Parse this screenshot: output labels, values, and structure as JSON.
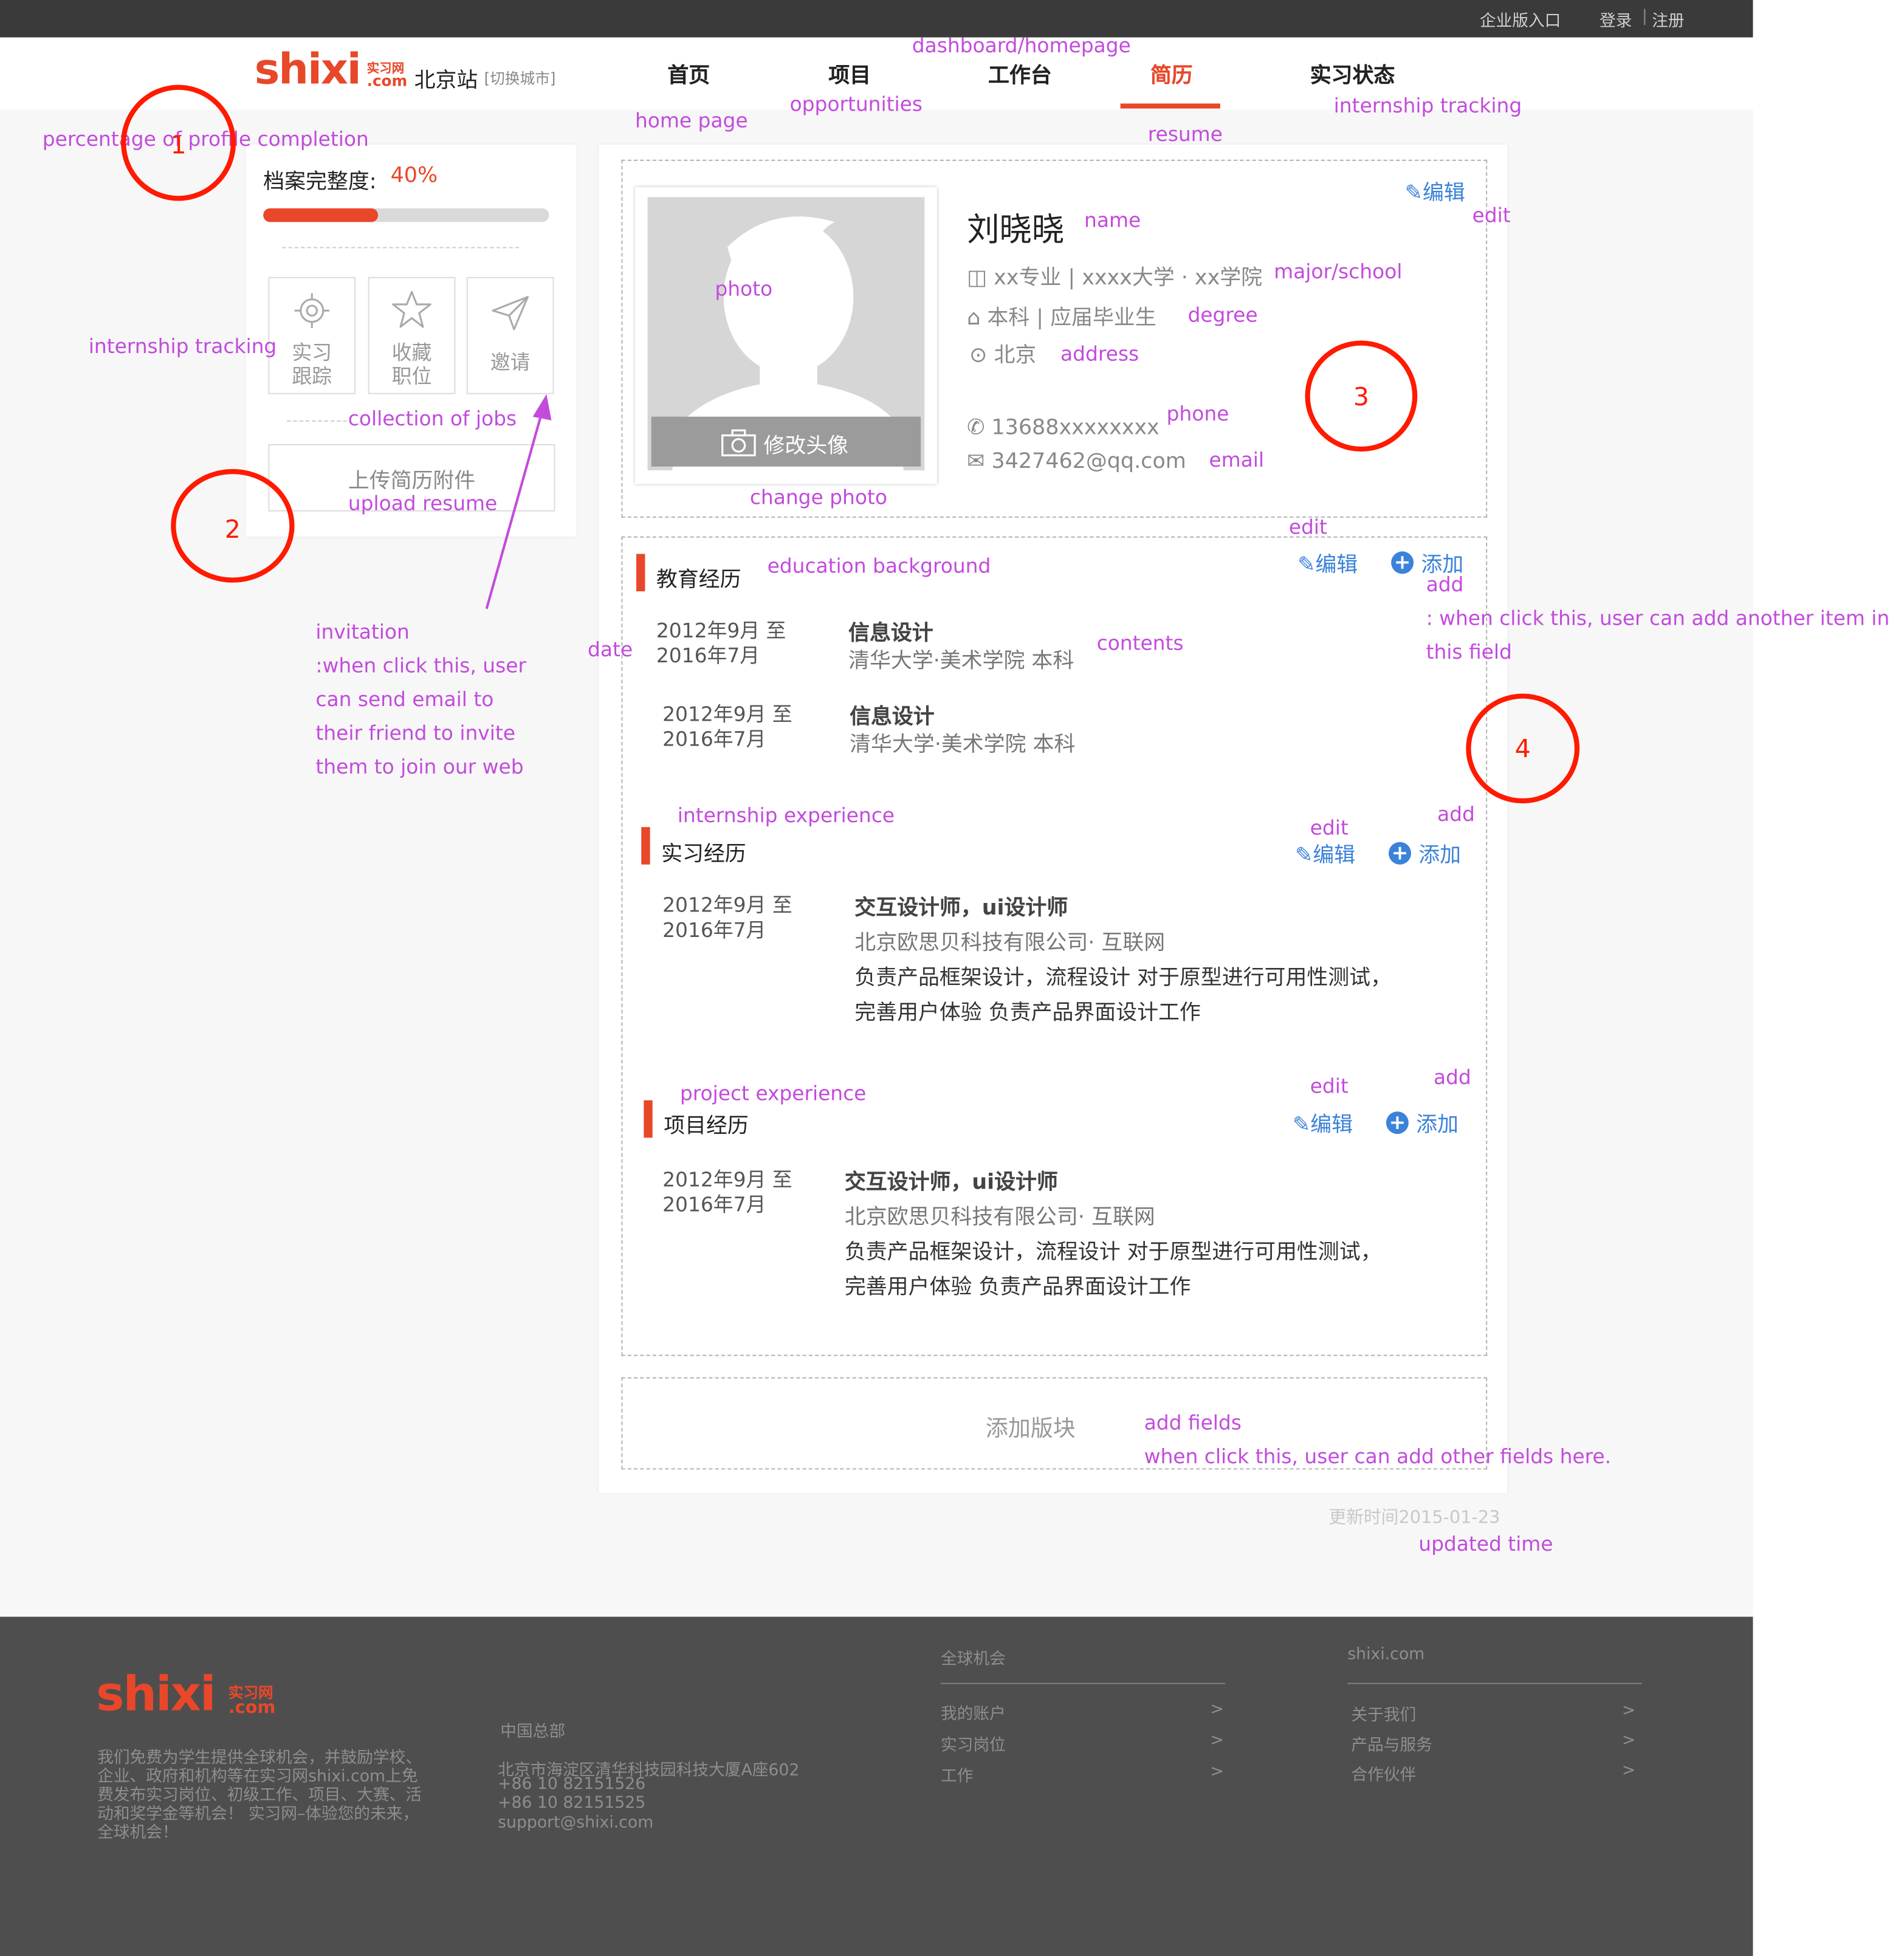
{
  "topbar": {
    "enterprise": "企业版入口",
    "login": "登录",
    "register": "注册"
  },
  "brand": {
    "logo_text": "shixi",
    "logo_small": "实习网",
    "logo_com": ".com",
    "city": "北京站",
    "switch_city": "[切换城市]"
  },
  "nav": {
    "items": [
      {
        "label": "首页",
        "active": false
      },
      {
        "label": "项目",
        "active": false
      },
      {
        "label": "工作台",
        "active": false
      },
      {
        "label": "简历",
        "active": true
      },
      {
        "label": "实习状态",
        "active": false
      }
    ]
  },
  "sidebar": {
    "completion_label": "档案完整度:",
    "completion_value": "40%",
    "completion_fraction": 0.4,
    "tiles": [
      {
        "label": "实习\n跟踪",
        "icon": "target-icon"
      },
      {
        "label": "收藏\n职位",
        "icon": "star-icon"
      },
      {
        "label": "邀请",
        "icon": "paper-plane-icon"
      }
    ],
    "upload_label": "上传简历附件"
  },
  "profile": {
    "edit_label": "编辑",
    "name": "刘晓晓",
    "major": "xx专业 | xxxx大学 · xx学院",
    "degree": "本科 | 应届毕业生",
    "address": "北京",
    "phone": "13688xxxxxxxx",
    "email": "3427462@qq.com",
    "change_photo": "修改头像"
  },
  "sections": {
    "edit_label": "编辑",
    "add_label": "添加",
    "education": {
      "title": "教育经历",
      "entries": [
        {
          "date1": "2012年9月 至",
          "date2": "2016年7月",
          "title": "信息设计",
          "sub": "清华大学·美术学院 本科"
        },
        {
          "date1": "2012年9月 至",
          "date2": "2016年7月",
          "title": "信息设计",
          "sub": "清华大学·美术学院 本科"
        }
      ]
    },
    "internship": {
      "title": "实习经历",
      "entry": {
        "date1": "2012年9月 至",
        "date2": "2016年7月",
        "title": "交互设计师，ui设计师",
        "sub": "北京欧思贝科技有限公司· 互联网",
        "desc1": "负责产品框架设计，流程设计 对于原型进行可用性测试，",
        "desc2": "完善用户体验 负责产品界面设计工作"
      }
    },
    "project": {
      "title": "项目经历",
      "entry": {
        "date1": "2012年9月 至",
        "date2": "2016年7月",
        "title": "交互设计师，ui设计师",
        "sub": "北京欧思贝科技有限公司· 互联网",
        "desc1": "负责产品框架设计，流程设计 对于原型进行可用性测试，",
        "desc2": "完善用户体验 负责产品界面设计工作"
      }
    },
    "add_block": "添加版块",
    "updated": "更新时间2015-01-23"
  },
  "annotations": {
    "dashboard": "dashboard/homepage",
    "home_page": "home page",
    "opportunities": "opportunities",
    "resume": "resume",
    "internship_tracking_nav": "internship tracking",
    "percentage": "percentage of profile completion",
    "internship_tracking": "internship tracking",
    "collection": "collection of jobs",
    "upload_resume": "upload resume",
    "invitation": [
      "invitation",
      ":when click this, user",
      "can send email to",
      "their friend to invite",
      "them to join our web"
    ],
    "photo": "photo",
    "change_photo": "change photo",
    "name": "name",
    "major_school": "major/school",
    "degree": "degree",
    "address": "address",
    "phone": "phone",
    "email": "email",
    "edit_top": "edit",
    "edit_edu": "edit",
    "education_background": "education background",
    "add_edu": "add",
    "add_note1": ": when click this, user can add another item in",
    "add_note2": "this field",
    "date": "date",
    "contents": "contents",
    "internship_experience": "internship experience",
    "edit_intern": "edit",
    "add_intern": "add",
    "project_experience": "project experience",
    "edit_project": "edit",
    "add_project": "add",
    "add_fields": "add fields",
    "add_fields_note": "when click this, user can add other fields here.",
    "updated_time": "updated time",
    "circle_1": "1",
    "circle_2": "2",
    "circle_3": "3",
    "circle_4": "4"
  },
  "footer": {
    "description": "我们免费为学生提供全球机会，并鼓励学校、企业、政府和机构等在实习网shixi.com上免费发布实习岗位、初级工作、项目、大赛、活动和奖学金等机会！ 实习网–体验您的未来，全球机会！",
    "hq_title": "中国总部",
    "hq_address": "北京市海淀区清华科技园科技大厦A座602",
    "hq_phone1": "+86 10 82151526",
    "hq_phone2": "+86 10 82151525",
    "hq_email": "support@shixi.com",
    "col1_title": "全球机会",
    "col1_items": [
      "我的账户",
      "实习岗位",
      "工作"
    ],
    "col2_title": "shixi.com",
    "col2_items": [
      "关于我们",
      "产品与服务",
      "合作伙伴"
    ],
    "arrow": ">"
  },
  "colors": {
    "accent": "#e8472a",
    "link": "#3b82d9",
    "annotation": "#c24bdc",
    "circle": "#ff1a00"
  }
}
